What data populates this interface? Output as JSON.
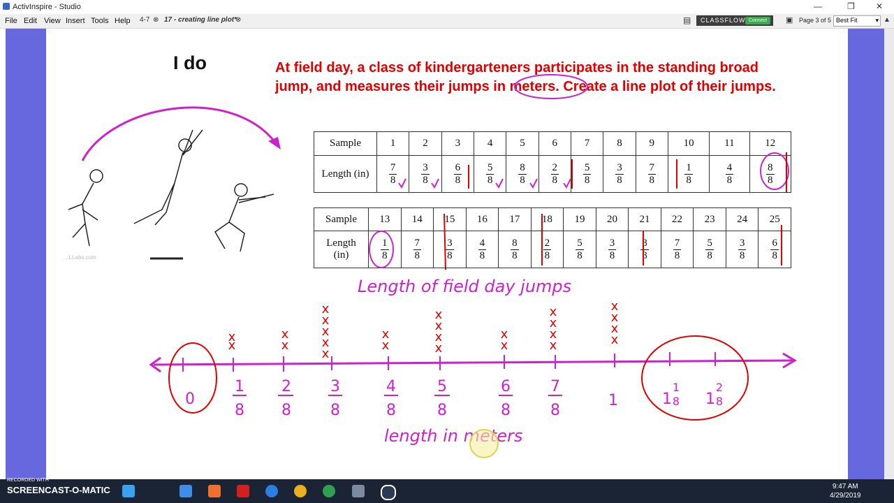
{
  "app": {
    "title": "ActivInspire - Studio"
  },
  "menu": [
    "File",
    "Edit",
    "View",
    "Insert",
    "Tools",
    "Help"
  ],
  "tabs": [
    {
      "label": "4-7"
    },
    {
      "label": "17 - creating line plot*"
    }
  ],
  "classflow": {
    "label": "CLASSFLOW",
    "connect": "Connect"
  },
  "page_indicator": "Page 3 of 5",
  "zoom": "Best Fit",
  "slide": {
    "heading": "I do",
    "problem_line1": "At field day, a class of kindergarteners participates in the standing broad",
    "problem_line2": "jump, and measures their jumps in meters.  Create a line plot of their jumps.",
    "table1": {
      "row_labels": [
        "Sample",
        "Length (in)"
      ],
      "samples": [
        "1",
        "2",
        "3",
        "4",
        "5",
        "6",
        "7",
        "8",
        "9",
        "10",
        "11",
        "12"
      ],
      "numerators": [
        "7",
        "3",
        "6",
        "5",
        "8",
        "2",
        "5",
        "3",
        "7",
        "1",
        "4",
        "8"
      ],
      "denominators": [
        "8",
        "8",
        "8",
        "8",
        "8",
        "8",
        "8",
        "8",
        "8",
        "8",
        "8",
        "8"
      ]
    },
    "table2": {
      "row_labels": [
        "Sample",
        "Length",
        "(in)"
      ],
      "samples": [
        "13",
        "14",
        "15",
        "16",
        "17",
        "18",
        "19",
        "20",
        "21",
        "22",
        "23",
        "24",
        "25"
      ],
      "numerators": [
        "1",
        "7",
        "3",
        "4",
        "8",
        "2",
        "5",
        "3",
        "8",
        "7",
        "5",
        "3",
        "6"
      ],
      "denominators": [
        "8",
        "8",
        "8",
        "8",
        "8",
        "8",
        "8",
        "8",
        "8",
        "8",
        "8",
        "8",
        "8"
      ]
    },
    "watermark": "...LLabs.com"
  },
  "colors": {
    "accent_red": "#e00000",
    "ink_magenta": "#cc22cc",
    "band": "#6868de"
  },
  "taskbar": {
    "recorded": "RECORDED WITH",
    "screencast": "SCREENCAST-O-MATIC",
    "time": "9:47 AM",
    "date": "4/29/2019"
  }
}
